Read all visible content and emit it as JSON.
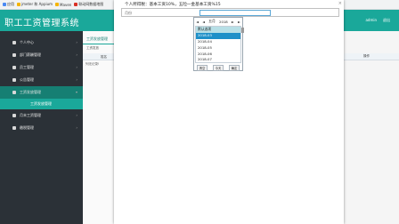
{
  "browser": {
    "bookmarks": [
      {
        "label": "应用",
        "color": "#4a8af4"
      },
      {
        "label": "jmeter 和 Appium",
        "color": "#f4b400"
      },
      {
        "label": "Maven",
        "color": "#f4b400"
      },
      {
        "label": "联动网数据地图",
        "color": "#d93025"
      }
    ]
  },
  "app": {
    "title": "职工工资管理系统",
    "header_user": "admin",
    "header_logout": "退出"
  },
  "sidebar": {
    "items": [
      {
        "label": "个人中心"
      },
      {
        "label": "部门薪酬管理"
      },
      {
        "label": "员工管理"
      },
      {
        "label": "公告管理"
      },
      {
        "label": "工资发放管理"
      },
      {
        "label": "工资发放管理"
      },
      {
        "label": "月末工资管理"
      },
      {
        "label": "缴税管理"
      }
    ]
  },
  "main": {
    "tab_label": "工资发放管理",
    "toolbar_text": "工资发放",
    "table_head_left": "姓名",
    "no_records": "列无记录!"
  },
  "modal": {
    "description": "个人所得税：基本工资10%，五险一金基本工资%15",
    "field_label": "月份",
    "close": "×"
  },
  "month_picker": {
    "prev_year": "◄",
    "prev_month": "◄",
    "month_label": "五月",
    "year_label": "2018",
    "next_month": "►",
    "next_year": "►",
    "options": [
      "默认选项",
      "2018-03",
      "2018-04",
      "2018-05",
      "2018-06",
      "2018-07"
    ],
    "clear": "清空",
    "today": "今天",
    "ok": "确定"
  },
  "right_panel": {
    "label": "操作"
  }
}
